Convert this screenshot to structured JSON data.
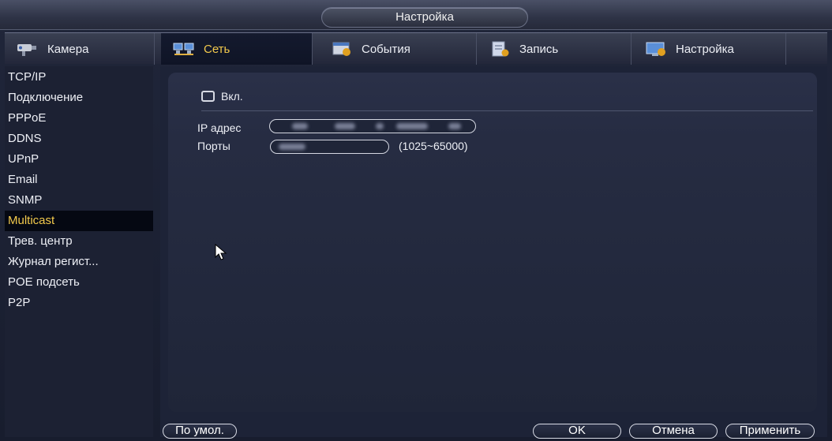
{
  "window": {
    "title": "Настройка"
  },
  "tabs": [
    {
      "label": "Камера",
      "icon": "camera-icon",
      "active": false
    },
    {
      "label": "Сеть",
      "icon": "network-icon",
      "active": true
    },
    {
      "label": "События",
      "icon": "events-icon",
      "active": false
    },
    {
      "label": "Запись",
      "icon": "record-icon",
      "active": false
    },
    {
      "label": "Настройка",
      "icon": "settings-icon",
      "active": false
    }
  ],
  "sidebar": {
    "items": [
      {
        "label": "TCP/IP"
      },
      {
        "label": "Подключение"
      },
      {
        "label": "PPPoE"
      },
      {
        "label": "DDNS"
      },
      {
        "label": "UPnP"
      },
      {
        "label": "Email"
      },
      {
        "label": "SNMP"
      },
      {
        "label": "Multicast"
      },
      {
        "label": "Трев. центр"
      },
      {
        "label": "Журнал регист..."
      },
      {
        "label": "POE подсеть"
      },
      {
        "label": "P2P"
      }
    ],
    "selected": "Multicast"
  },
  "form": {
    "enable_label": "Вкл.",
    "enable_checked": false,
    "ip_label": "IP адрес",
    "port_label": "Порты",
    "port_range": "(1025~65000)"
  },
  "buttons": {
    "default": "По умол.",
    "ok": "OK",
    "cancel": "Отмена",
    "apply": "Применить"
  },
  "colors": {
    "accent": "#f2c94c",
    "background": "#1d2337"
  }
}
